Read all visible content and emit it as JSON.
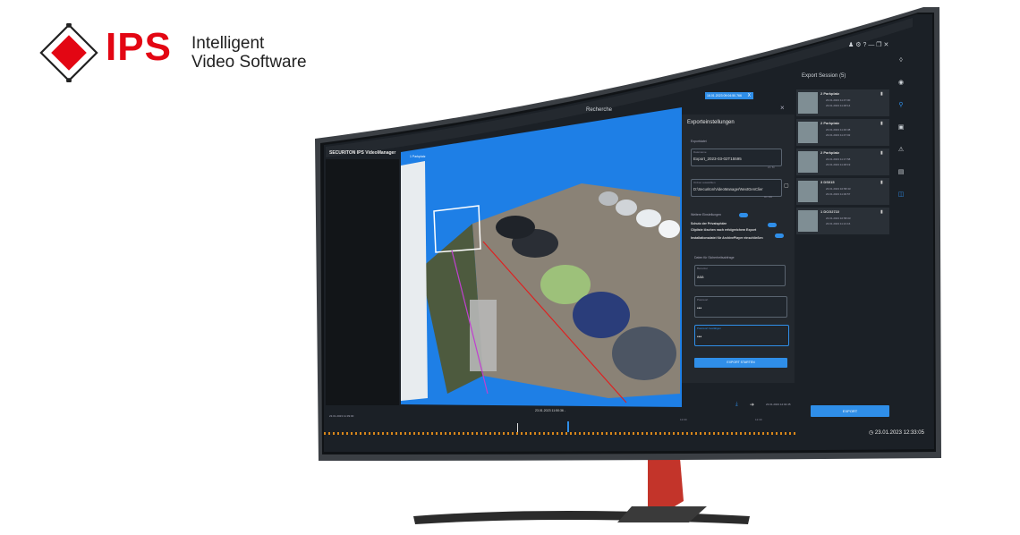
{
  "brand": {
    "logo_text": "IPS",
    "tagline_line1": "Intelligent",
    "tagline_line2": "Video Software",
    "accent_color": "#e30613"
  },
  "app": {
    "brand_label": "SECURITON IPS VideoManager",
    "title": "Recherche",
    "camera_label": "1 Parkplatz",
    "date_banner": "16.01.2023 09:04:50.766",
    "close_glyph": "X"
  },
  "export_dialog": {
    "title": "Exporteinstellungen",
    "close_glyph": "×",
    "section_exportdatei": "Exportdatei",
    "label_dateiname": "Dateiname",
    "value_dateiname": "Export_2023-03-02T15595",
    "counter": "24 / 50",
    "label_ordner": "Ordner auswählen",
    "value_ordner": "D:\\Securiton\\VideoManager\\NextGenClier",
    "ordner_counter": "40 / 260",
    "section_weitere": "Weitere Einstellungen",
    "opt_privatsphaere": "Schutz der Privatsphäre",
    "opt_clipliste": "Clipliste löschen nach erfolgreichem Export",
    "opt_installation": "Installationsdatei für ArchivePlayer einschließen",
    "section_sicherheit": "Daten für Sicherheitsabfrage",
    "label_benutzer": "Benutzer",
    "value_benutzer": "aaa",
    "label_passwort": "Passwort",
    "value_passwort": "•••",
    "label_passwort_bestaetigen": "Passwort bestätigen",
    "value_passwort_bestaetigen": "•••",
    "start_button": "EXPORT STARTEN"
  },
  "session": {
    "title": "Export Session (5)",
    "items": [
      {
        "name": "2 Parkplatz",
        "start": "23.01.2023 11:47:00",
        "end": "23.01.2023 11:48:14"
      },
      {
        "name": "2 Parkplatz",
        "start": "23.01.2023 11:46:38",
        "end": "23.01.2023 11:47:02"
      },
      {
        "name": "2 Parkplatz",
        "start": "23.01.2023 11:17:58",
        "end": "23.01.2023 11:48:19"
      },
      {
        "name": "3 DS015",
        "start": "23.01.2023 10:58:33",
        "end": "23.01.2023 11:00:57"
      },
      {
        "name": "1 DCG2722",
        "start": "23.01.2023 10:58:03",
        "end": "23.01.2023 11:21:16"
      }
    ],
    "export_button": "EXPORT"
  },
  "timeline": {
    "left_date": "23.01.2023 11:39:00",
    "center_date": "23.01.2023",
    "center_time": "11:50:36 -",
    "right_date": "23.01.2023 12:02:45",
    "tick_1": "12:00",
    "tick_2": "12:30",
    "clock": "23.01.2023 12:33:05"
  }
}
